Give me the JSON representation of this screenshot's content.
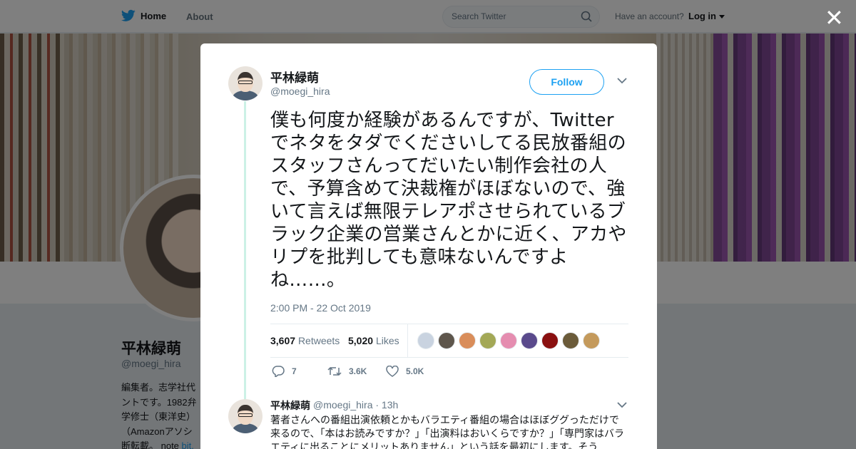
{
  "nav": {
    "home_label": "Home",
    "about_label": "About",
    "search_placeholder": "Search Twitter",
    "account_prompt": "Have an account?",
    "login_label": "Log in"
  },
  "profile": {
    "name": "平林緑萌",
    "handle": "@moegi_hira",
    "bio_lines": [
      "編集者。志学社代",
      "ントです。1982弁",
      "学修士（東洋史）",
      "（Amazonアソシ",
      "断転載。 note"
    ],
    "bio_link": "bit."
  },
  "tweet": {
    "author_name": "平林緑萌",
    "author_handle": "@moegi_hira",
    "follow_label": "Follow",
    "text": "僕も何度か経験があるんですが、Twitterでネタをタダでくださいしてる民放番組のスタッフさんってだいたい制作会社の人で、予算含めて決裁権がほぼないので、強いて言えば無限テレアポさせられているブラック企業の営業さんとかに近く、アカやリプを批判しても意味ないんですよね……。",
    "timestamp": "2:00 PM - 22 Oct 2019",
    "retweets_count": "3,607",
    "retweets_label": "Retweets",
    "likes_count": "5,020",
    "likes_label": "Likes",
    "likers": [
      "#c9d3e0",
      "#5e564c",
      "#d98d5a",
      "#a3a856",
      "#e58db0",
      "#5a4a8c",
      "#8a1010",
      "#6b5b3a",
      "#c49a5c"
    ],
    "reply_count": "7",
    "retweet_short": "3.6K",
    "like_short": "5.0K"
  },
  "reply": {
    "author_name": "平林緑萌",
    "author_handle": "@moegi_hira",
    "time": "· 13h",
    "text": "著者さんへの番組出演依頼とかもバラエティ番組の場合はほぼググっただけで来るので、「本はお読みですか？」「出演料はおいくらですか？」「専門家はバラエティに出ることにメリットありません」という話を最初にします。そう"
  },
  "colors": {
    "accent": "#1da1f2",
    "muted": "#657786",
    "thread_line": "#ccf1e6"
  }
}
